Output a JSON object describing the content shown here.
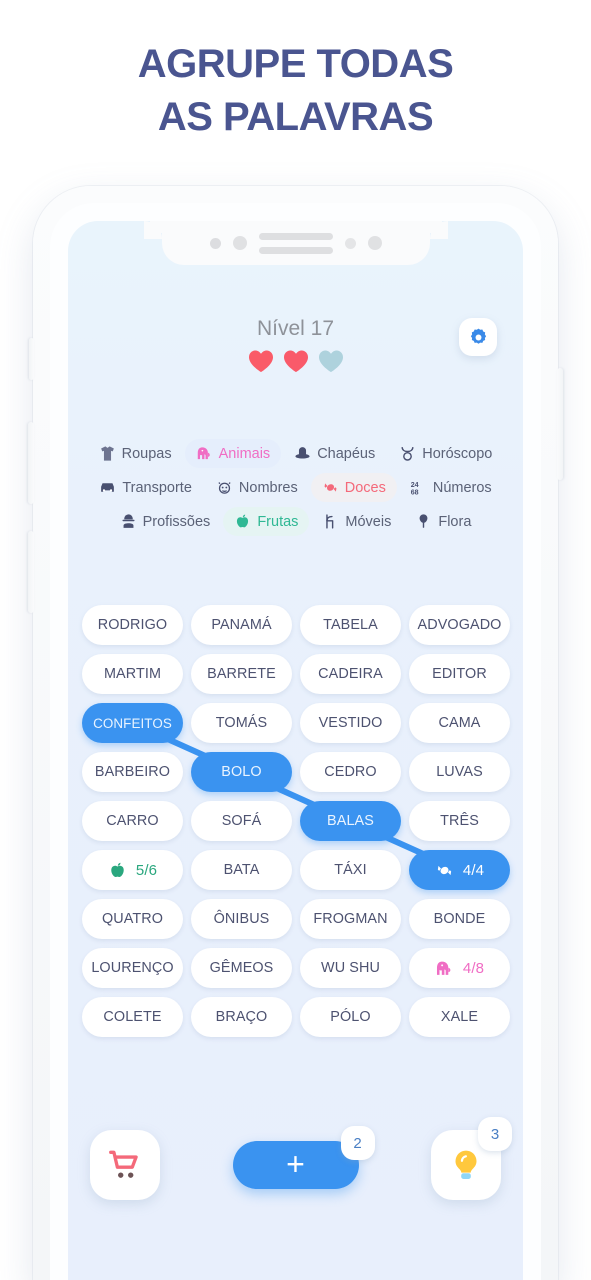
{
  "headline": {
    "line1": "AGRUPE TODAS",
    "line2": "AS PALAVRAS",
    "color": "#4a5590"
  },
  "header": {
    "level_label": "Nível 17",
    "lives": {
      "total": 3,
      "remaining": 2,
      "full_color": "#fa5b68",
      "empty_color": "#a9cfda"
    },
    "settings_icon": "gear-icon"
  },
  "categories": [
    {
      "label": "Roupas",
      "icon": "tshirt-icon",
      "active": false,
      "color": "#5b6277"
    },
    {
      "label": "Animais",
      "icon": "elephant-icon",
      "active": true,
      "color": "#f06dc4"
    },
    {
      "label": "Chapéus",
      "icon": "hat-icon",
      "active": false,
      "color": "#5b6277"
    },
    {
      "label": "Horóscopo",
      "icon": "taurus-icon",
      "active": false,
      "color": "#5b6277"
    },
    {
      "label": "Transporte",
      "icon": "car-icon",
      "active": false,
      "color": "#5b6277"
    },
    {
      "label": "Nombres",
      "icon": "face-icon",
      "active": false,
      "color": "#5b6277"
    },
    {
      "label": "Doces",
      "icon": "candy-icon",
      "active": true,
      "color": "#f4697a"
    },
    {
      "label": "Números",
      "icon": "numbers-icon",
      "active": false,
      "color": "#5b6277"
    },
    {
      "label": "Profissões",
      "icon": "worker-icon",
      "active": false,
      "color": "#5b6277"
    },
    {
      "label": "Frutas",
      "icon": "apple-icon",
      "active": true,
      "color": "#2fb894"
    },
    {
      "label": "Móveis",
      "icon": "chair-icon",
      "active": false,
      "color": "#5b6277"
    },
    {
      "label": "Flora",
      "icon": "flower-icon",
      "active": false,
      "color": "#5b6277"
    }
  ],
  "grid": {
    "columns": 4,
    "cells": [
      {
        "label": "RODRIGO",
        "type": "word",
        "selected": false
      },
      {
        "label": "PANAMÁ",
        "type": "word",
        "selected": false
      },
      {
        "label": "TABELA",
        "type": "word",
        "selected": false
      },
      {
        "label": "ADVOGADO",
        "type": "word",
        "selected": false
      },
      {
        "label": "MARTIM",
        "type": "word",
        "selected": false
      },
      {
        "label": "BARRETE",
        "type": "word",
        "selected": false
      },
      {
        "label": "CADEIRA",
        "type": "word",
        "selected": false
      },
      {
        "label": "EDITOR",
        "type": "word",
        "selected": false
      },
      {
        "label": "CONFEITOS",
        "type": "word",
        "selected": true
      },
      {
        "label": "TOMÁS",
        "type": "word",
        "selected": false
      },
      {
        "label": "VESTIDO",
        "type": "word",
        "selected": false
      },
      {
        "label": "CAMA",
        "type": "word",
        "selected": false
      },
      {
        "label": "BARBEIRO",
        "type": "word",
        "selected": false
      },
      {
        "label": "BOLO",
        "type": "word",
        "selected": true
      },
      {
        "label": "CEDRO",
        "type": "word",
        "selected": false
      },
      {
        "label": "LUVAS",
        "type": "word",
        "selected": false
      },
      {
        "label": "CARRO",
        "type": "word",
        "selected": false
      },
      {
        "label": "SOFÁ",
        "type": "word",
        "selected": false
      },
      {
        "label": "BALAS",
        "type": "word",
        "selected": true
      },
      {
        "label": "TRÊS",
        "type": "word",
        "selected": false
      },
      {
        "label": "5/6",
        "type": "counter",
        "icon": "apple-icon",
        "selected": false,
        "color": "#2aa77e"
      },
      {
        "label": "BATA",
        "type": "word",
        "selected": false
      },
      {
        "label": "TÁXI",
        "type": "word",
        "selected": false
      },
      {
        "label": "4/4",
        "type": "counter",
        "icon": "candy-icon",
        "selected": true,
        "color": "#ffffff"
      },
      {
        "label": "QUATRO",
        "type": "word",
        "selected": false
      },
      {
        "label": "ÔNIBUS",
        "type": "word",
        "selected": false
      },
      {
        "label": "FROGMAN",
        "type": "word",
        "selected": false
      },
      {
        "label": "BONDE",
        "type": "word",
        "selected": false
      },
      {
        "label": "LOURENÇO",
        "type": "word",
        "selected": false
      },
      {
        "label": "GÊMEOS",
        "type": "word",
        "selected": false
      },
      {
        "label": "WU SHU",
        "type": "word",
        "selected": false
      },
      {
        "label": "4/8",
        "type": "counter",
        "icon": "elephant-icon",
        "selected": false,
        "color": "#f06dc4"
      },
      {
        "label": "COLETE",
        "type": "word",
        "selected": false
      },
      {
        "label": "BRAÇO",
        "type": "word",
        "selected": false
      },
      {
        "label": "PÓLO",
        "type": "word",
        "selected": false
      },
      {
        "label": "XALE",
        "type": "word",
        "selected": false
      }
    ],
    "selection_path": [
      "CONFEITOS",
      "BOLO",
      "BALAS",
      "4/4"
    ],
    "link_color": "#3a93f0"
  },
  "bottom_bar": {
    "cart": {
      "icon": "shopping-cart-icon",
      "color": "#f4697a"
    },
    "add": {
      "icon": "plus-icon",
      "badge": "2",
      "color": "#3a93f0"
    },
    "hint": {
      "icon": "lightbulb-icon",
      "badge": "3",
      "color": "#ffc83d"
    }
  }
}
